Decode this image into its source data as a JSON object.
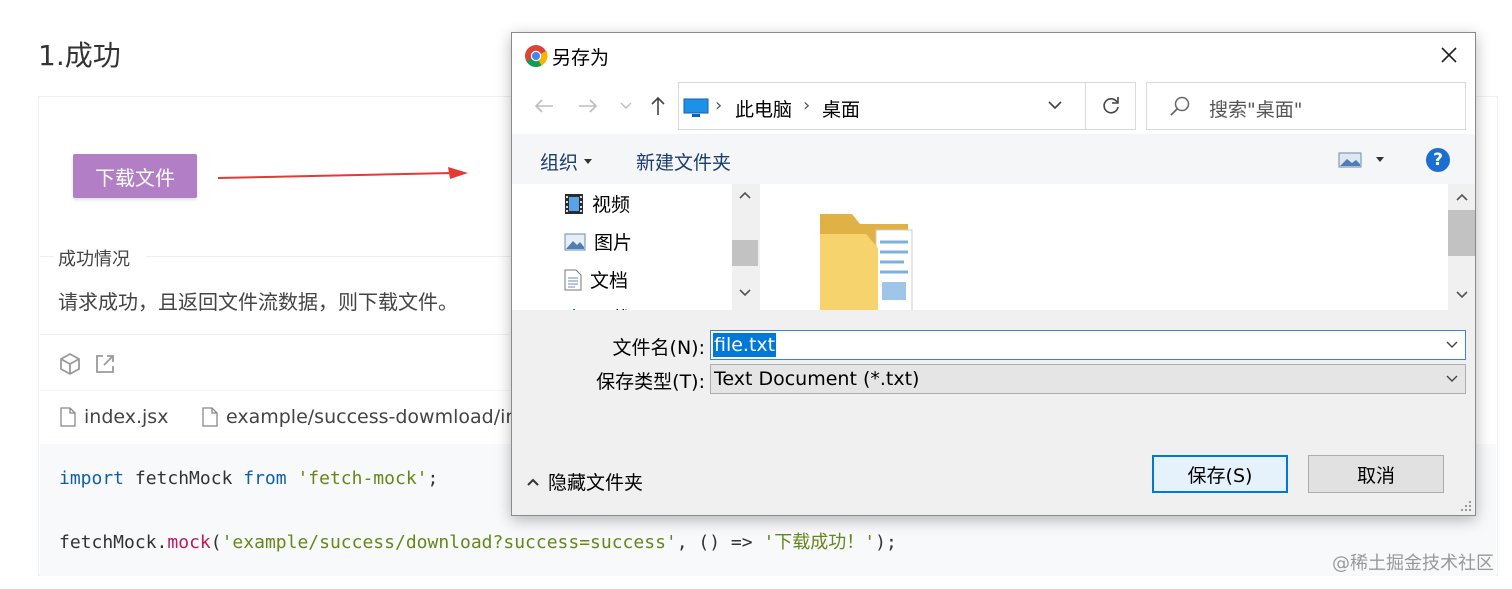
{
  "page": {
    "heading": "1.成功",
    "demo_button": "下载文件",
    "section_title": "成功情况",
    "section_desc": "请求成功，且返回文件流数据，则下载文件。",
    "file_tabs": [
      "index.jsx",
      "example/success-dowmload/inde"
    ],
    "code": {
      "line1": {
        "kw_import": "import",
        "ident": " fetchMock ",
        "kw_from": "from",
        "sp": " ",
        "str": "'fetch-mock'",
        "end": ";"
      },
      "line2": {
        "obj": "fetchMock",
        "dot": ".",
        "method": "mock",
        "open": "(",
        "str1": "'example/success/download?success=success'",
        "mid": ", () => ",
        "str2": "'下载成功！'",
        "end": ");"
      }
    },
    "watermark": "@稀土掘金技术社区"
  },
  "dialog": {
    "title": "另存为",
    "breadcrumb": [
      "此电脑",
      "桌面"
    ],
    "search_placeholder": "搜索\"桌面\"",
    "toolbar": {
      "organize": "组织",
      "new_folder": "新建文件夹",
      "help": "?"
    },
    "tree_items": [
      "视频",
      "图片",
      "文档",
      "下载"
    ],
    "filename_label": "文件名(N):",
    "filename_value": "file.txt",
    "filetype_label": "保存类型(T):",
    "filetype_value": "Text Document (*.txt)",
    "hide_folders": "隐藏文件夹",
    "save_button": "保存(S)",
    "cancel_button": "取消"
  },
  "colors": {
    "accent": "#b27fc6",
    "selection": "#0078d7",
    "link_blue": "#1a3d6e",
    "help_blue": "#1c6fd1"
  }
}
